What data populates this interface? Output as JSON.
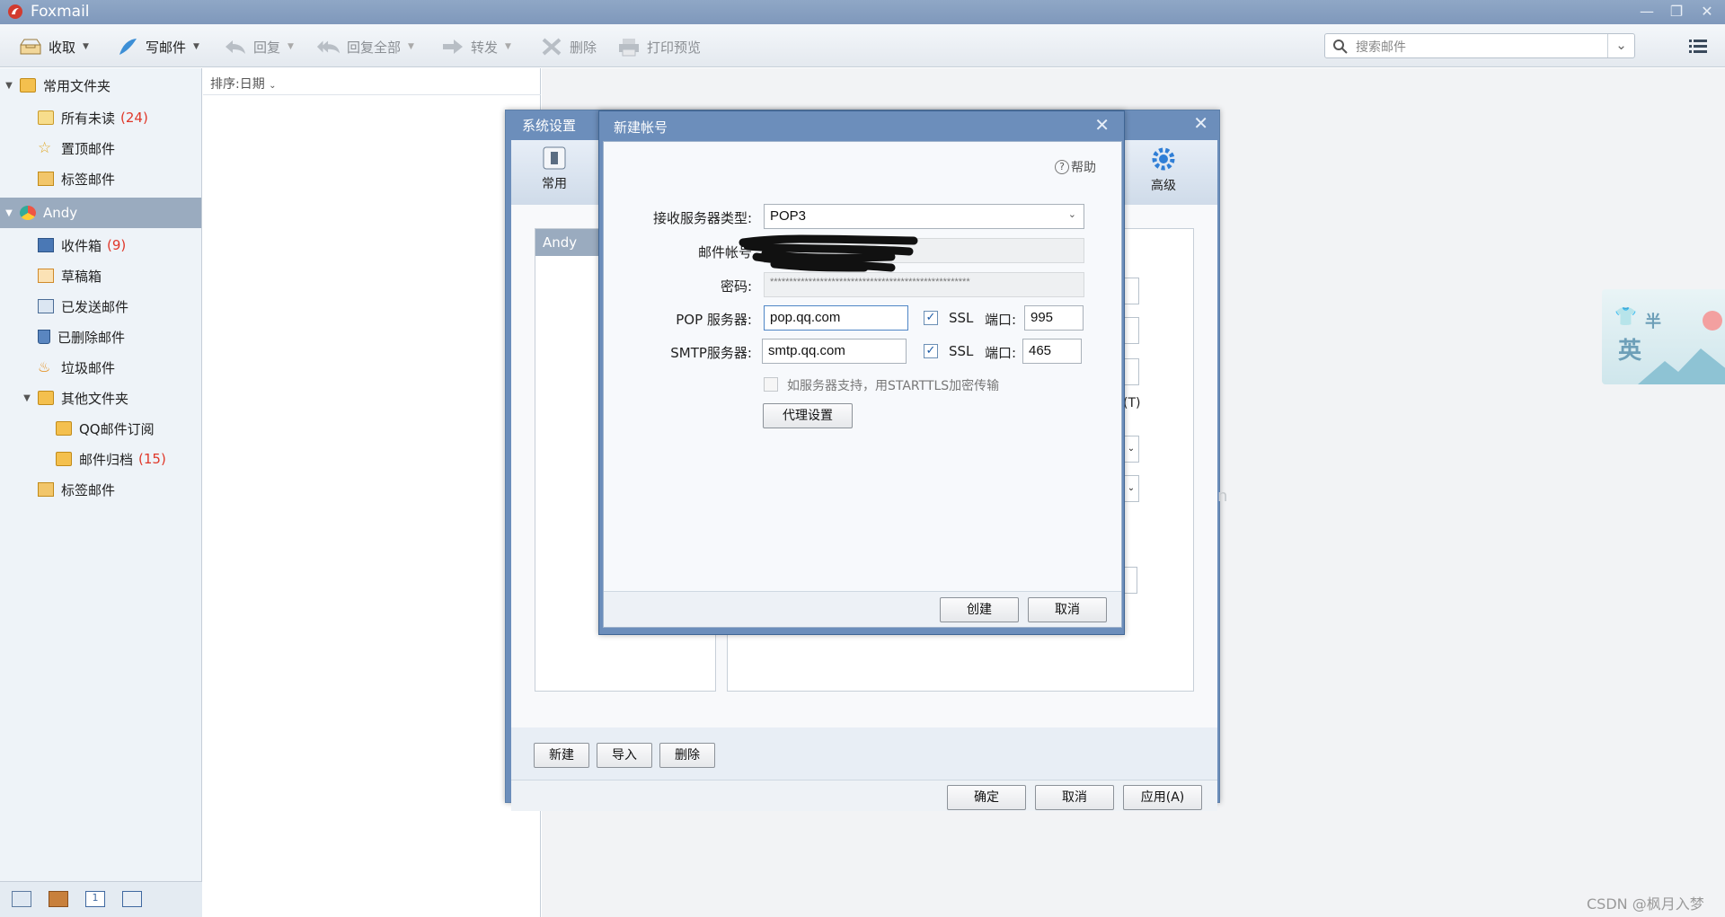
{
  "app": {
    "title": "Foxmail"
  },
  "toolbar": {
    "receive": "收取",
    "compose": "写邮件",
    "reply": "回复",
    "reply_all": "回复全部",
    "forward": "转发",
    "delete": "删除",
    "print_preview": "打印预览"
  },
  "search": {
    "placeholder": "搜索邮件"
  },
  "sidebar": {
    "common_folder": "常用文件夹",
    "all_unread": "所有未读",
    "all_unread_count": "(24)",
    "pinned": "置顶邮件",
    "tagged": "标签邮件",
    "account": "Andy",
    "inbox": "收件箱",
    "inbox_count": "(9)",
    "drafts": "草稿箱",
    "sent": "已发送邮件",
    "deleted": "已删除邮件",
    "junk": "垃圾邮件",
    "other_folders": "其他文件夹",
    "qq_subscribe": "QQ邮件订阅",
    "archive": "邮件归档",
    "archive_count": "(15)",
    "tagged2": "标签邮件"
  },
  "list": {
    "sort_label": "排序:日期"
  },
  "system_settings": {
    "title": "系统设置",
    "tab_common": "常用",
    "tab_advanced": "高级",
    "account_selected": "Andy",
    "new_btn": "新建",
    "import_btn": "导入",
    "delete_btn": "删除",
    "ok_btn": "确定",
    "cancel_btn": "取消",
    "apply_btn": "应用(A)",
    "partial_text": "(T)",
    "partial_n": "n"
  },
  "new_account": {
    "title": "新建帐号",
    "help": "帮助",
    "server_type_label": "接收服务器类型:",
    "server_type_value": "POP3",
    "email_label": "邮件帐号",
    "password_label": "密码:",
    "password_value": "****************************************************",
    "pop_label": "POP 服务器:",
    "pop_value": "pop.qq.com",
    "smtp_label": "SMTP服务器:",
    "smtp_value": "smtp.qq.com",
    "ssl": "SSL",
    "port_label": "端口:",
    "pop_port": "995",
    "smtp_port": "465",
    "starttls": "如服务器支持，用STARTTLS加密传输",
    "proxy_btn": "代理设置",
    "create_btn": "创建",
    "cancel_btn": "取消"
  },
  "watermark": "CSDN @枫月入梦",
  "widget": {
    "text1": "半",
    "text2": "英"
  }
}
